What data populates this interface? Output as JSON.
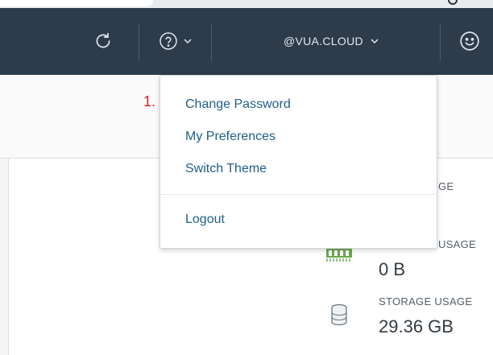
{
  "header": {
    "user_label": "@VUA.CLOUD",
    "icons": {
      "refresh": "refresh-icon",
      "help": "help-circle-icon",
      "user_menu": "chevron-down-icon",
      "profile": "smiley-face-icon"
    }
  },
  "step_marker": "1.",
  "user_menu": {
    "items": [
      {
        "label": "Change Password"
      },
      {
        "label": "My Preferences"
      },
      {
        "label": "Switch Theme"
      }
    ],
    "logout_label": "Logout"
  },
  "usage": {
    "cpu_label_partial": "GE",
    "memory_label_partial": "USAGE",
    "memory_value": "0 B",
    "storage_label": "STORAGE USAGE",
    "storage_value": "29.36 GB"
  },
  "colors": {
    "header_bg": "#2d3b4a",
    "link": "#1f5f87",
    "annotation": "#e02020",
    "memory_icon": "#6aa84f"
  }
}
